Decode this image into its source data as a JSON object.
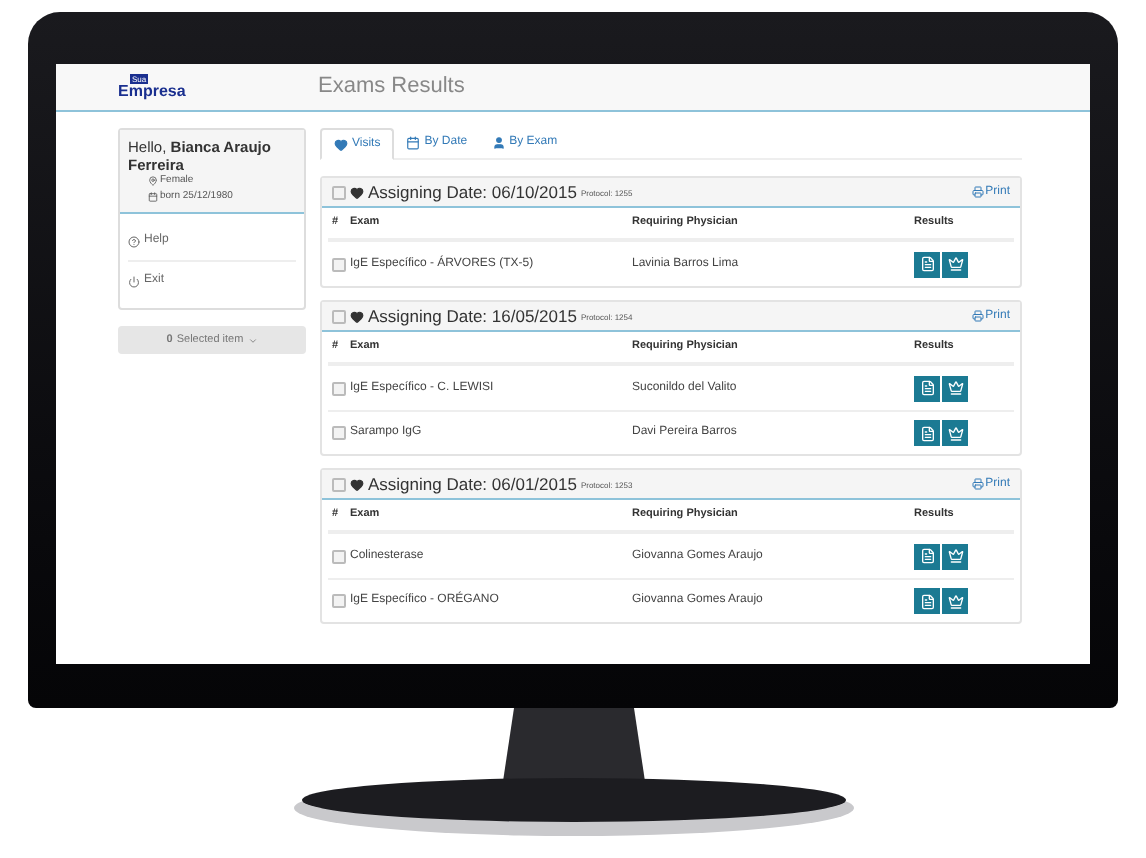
{
  "logo": {
    "badge": "Sua",
    "name": "Empresa"
  },
  "page_title": "Exams Results",
  "user": {
    "greeting": "Hello,",
    "name": "Bianca Araujo Ferreira",
    "gender": "Female",
    "born": "born 25/12/1980"
  },
  "menu": [
    {
      "label": "Help",
      "kind": "help"
    },
    {
      "label": "Exit",
      "kind": "exit"
    }
  ],
  "selection_button": {
    "count": "0",
    "label": "Selected item",
    "disabled": true
  },
  "tabs": [
    {
      "label": "Visits",
      "kind": "visits",
      "selected": true
    },
    {
      "label": "By Date",
      "kind": "date",
      "selected": false
    },
    {
      "label": "By Exam",
      "kind": "exam",
      "selected": false
    }
  ],
  "visits": [
    {
      "title": "Assigning Date: 06/10/2015",
      "protocol": "Protocol: 1255",
      "print": "Print",
      "checked": false,
      "columns": [
        "#",
        "Exam",
        "Requiring Physician",
        "Results"
      ],
      "rows": [
        {
          "exam": "IgE Específico - ÁRVORES (TX-5)",
          "physician": "Lavinia Barros Lima",
          "checked": false
        }
      ]
    },
    {
      "title": "Assigning Date: 16/05/2015",
      "protocol": "Protocol: 1254",
      "print": "Print",
      "checked": false,
      "columns": [
        "#",
        "Exam",
        "Requiring Physician",
        "Results"
      ],
      "rows": [
        {
          "exam": "IgE Específico - C. LEWISI",
          "physician": "Suconildo del Valito",
          "checked": false
        },
        {
          "exam": "Sarampo IgG",
          "physician": "Davi Pereira Barros",
          "checked": false
        }
      ]
    },
    {
      "title": "Assigning Date: 06/01/2015",
      "protocol": "Protocol: 1253",
      "print": "Print",
      "checked": false,
      "columns": [
        "#",
        "Exam",
        "Requiring Physician",
        "Results"
      ],
      "rows": [
        {
          "exam": "Colinesterase",
          "physician": "Giovanna Gomes Araujo",
          "checked": false
        },
        {
          "exam": "IgE Específico - ORÉGANO",
          "physician": "Giovanna Gomes Araujo",
          "checked": false
        }
      ]
    }
  ]
}
